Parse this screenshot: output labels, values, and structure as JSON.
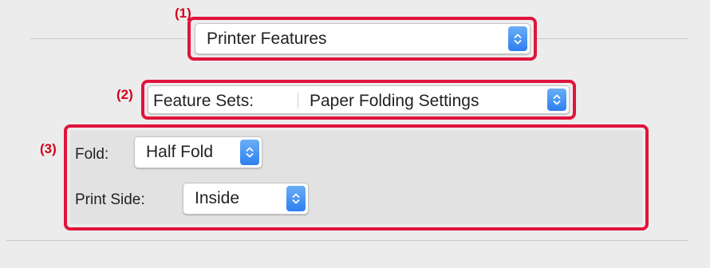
{
  "callouts": {
    "one": "(1)",
    "two": "(2)",
    "three": "(3)"
  },
  "printer_features_popup": {
    "value": "Printer Features"
  },
  "feature_sets": {
    "label": "Feature Sets:",
    "value": "Paper Folding Settings"
  },
  "fold": {
    "label": "Fold:",
    "value": "Half Fold"
  },
  "print_side": {
    "label": "Print Side:",
    "value": "Inside"
  },
  "colors": {
    "callout_red": "#e0143c",
    "accent_blue": "#2d7ff0",
    "window_bg": "#ececec"
  }
}
